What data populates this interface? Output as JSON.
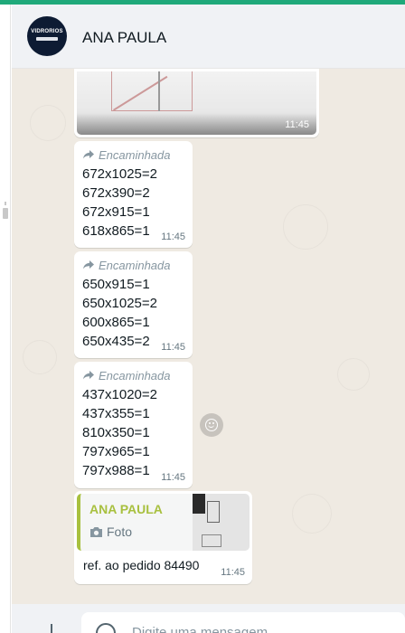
{
  "contact": {
    "name": "ANA PAULA",
    "avatar_text": "VIDRORIOS"
  },
  "image_message": {
    "time": "11:45"
  },
  "forwarded_label": "Encaminhada",
  "messages": [
    {
      "forwarded": true,
      "lines": [
        "672x1025=2",
        "672x390=2",
        "672x915=1",
        "618x865=1"
      ],
      "time": "11:45"
    },
    {
      "forwarded": true,
      "lines": [
        "650x915=1",
        "650x1025=2",
        "600x865=1",
        "650x435=2"
      ],
      "time": "11:45"
    },
    {
      "forwarded": true,
      "lines": [
        "437x1020=2",
        "437x355=1",
        "810x350=1",
        "797x965=1",
        "797x988=1"
      ],
      "time": "11:45"
    }
  ],
  "reply_message": {
    "quoted_name": "ANA PAULA",
    "quoted_type": "Foto",
    "text": "ref. ao pedido 84490",
    "time": "11:45"
  },
  "composer": {
    "placeholder": "Digite uma mensagem"
  },
  "colors": {
    "accent": "#1fa97a",
    "quote_bar": "#a8c03f",
    "chat_bg": "#efeae2",
    "header_bg": "#f0f2f5"
  }
}
